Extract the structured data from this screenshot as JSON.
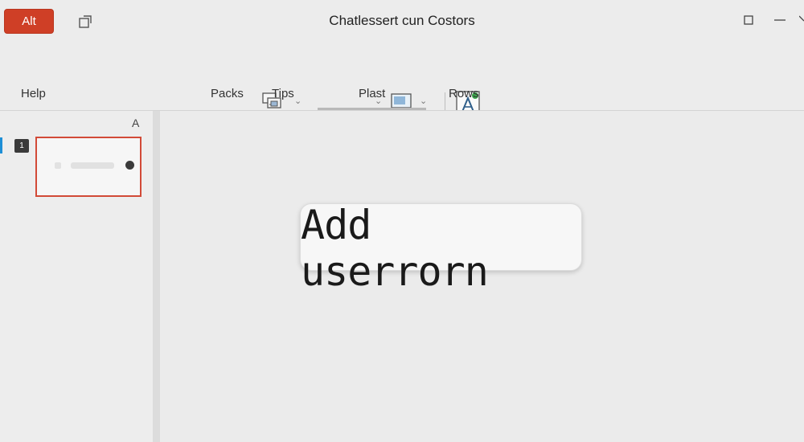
{
  "titlebar": {
    "app_button_label": "Alt",
    "window_title": "Chatlessert cun Costors",
    "icons": [
      "share-icon",
      "maximize-icon",
      "minimize-icon",
      "close-icon"
    ]
  },
  "ribbon": {
    "tabs": [
      {
        "label": "Help"
      },
      {
        "label": "Packs"
      },
      {
        "label": "Tips"
      },
      {
        "label": "Plast"
      },
      {
        "label": "Rows"
      }
    ],
    "active_tab": "Plast",
    "icons": [
      "layers-icon",
      "chevron-down-icon",
      "monitor-icon",
      "text-art-icon"
    ]
  },
  "left_pane": {
    "header_label": "A",
    "slides": [
      {
        "number": "1",
        "selected": true
      }
    ]
  },
  "canvas": {
    "card_text": "Add userrorn"
  },
  "colors": {
    "accent_red": "#cf3f26",
    "selection_border": "#d24a37",
    "selection_marker": "#1e8fd6",
    "background": "#ececec"
  }
}
